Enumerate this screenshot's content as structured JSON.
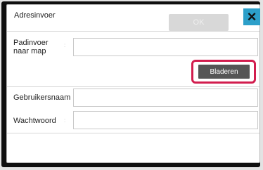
{
  "dialog": {
    "title": "Adresinvoer",
    "ok_label": "OK",
    "close_icon": "close-icon"
  },
  "fields": {
    "folder_path": {
      "label_line1": "Padinvoer",
      "label_line2": "naar map",
      "value": ""
    },
    "username": {
      "label": "Gebruikersnaam",
      "value": ""
    },
    "password": {
      "label": "Wachtwoord",
      "value": ""
    }
  },
  "browse_label": "Bladeren",
  "colon_glyph": ":",
  "colors": {
    "highlight": "#d21d4e",
    "close_button": "#2c9fc9",
    "browse_button": "#555555"
  }
}
